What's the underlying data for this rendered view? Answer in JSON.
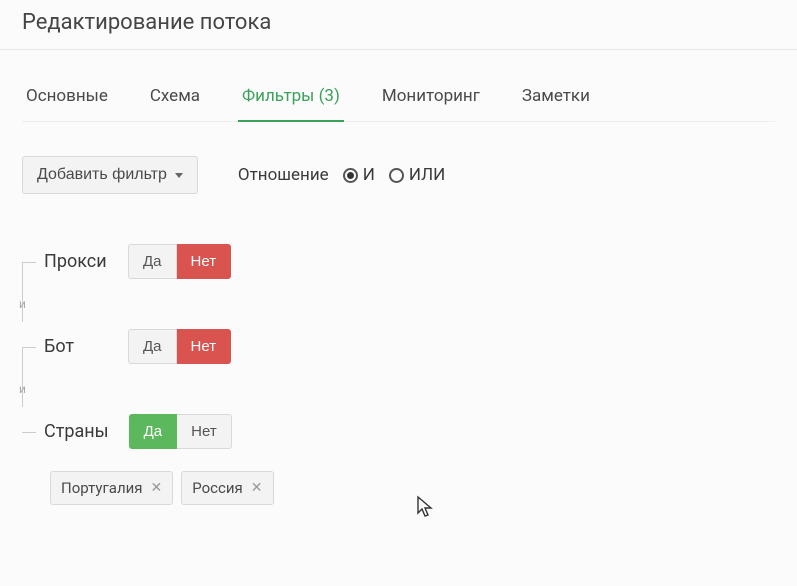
{
  "page_title": "Редактирование потока",
  "tabs": {
    "main": "Основные",
    "schema": "Схема",
    "filters": "Фильтры (3)",
    "monitoring": "Мониторинг",
    "notes": "Заметки"
  },
  "toolbar": {
    "add_filter": "Добавить фильтр",
    "relation_label": "Отношение",
    "relation_and": "И",
    "relation_or": "ИЛИ"
  },
  "connector_label": "и",
  "filters": {
    "proxy": {
      "label": "Прокси",
      "yes": "Да",
      "no": "Нет",
      "value": "no"
    },
    "bot": {
      "label": "Бот",
      "yes": "Да",
      "no": "Нет",
      "value": "no"
    },
    "countries": {
      "label": "Страны",
      "yes": "Да",
      "no": "Нет",
      "value": "yes",
      "tags": [
        "Португалия",
        "Россия"
      ]
    }
  }
}
